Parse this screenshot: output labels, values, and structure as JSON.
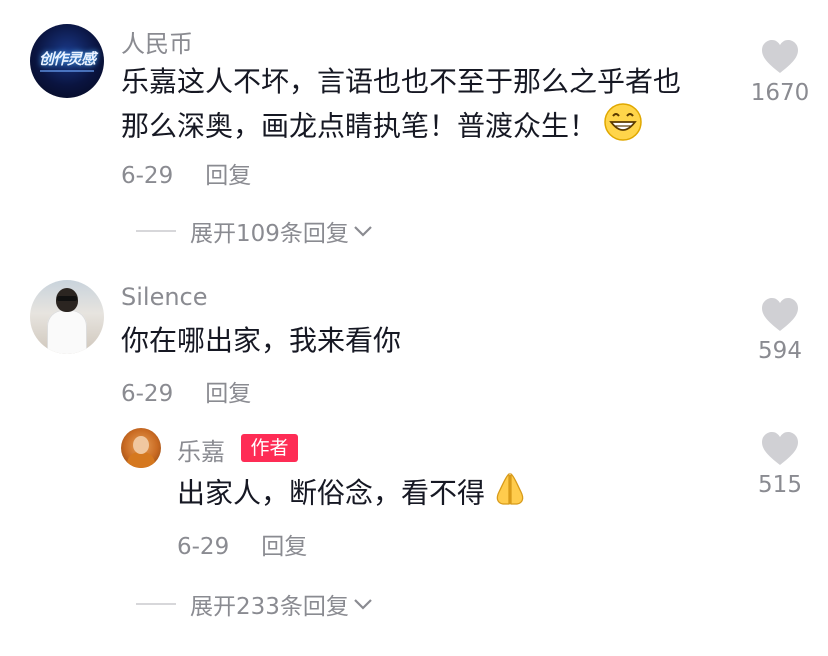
{
  "comments": [
    {
      "username": "人民币",
      "avatar_logo_text": "创作灵感",
      "text_line1": "乐嘉这人不坏，言语也也不至于那么之乎者也",
      "text_line2": "那么深奥，画龙点睛执笔！普渡众生！",
      "emoji": "grinning-face-emoji",
      "date": "6-29",
      "reply_label": "回复",
      "likes": "1670",
      "expand_label": "展开109条回复"
    },
    {
      "username": "Silence",
      "text_line1": "你在哪出家，我来看你",
      "date": "6-29",
      "reply_label": "回复",
      "likes": "594",
      "replies": [
        {
          "username": "乐嘉",
          "badge": "作者",
          "text_line1": "出家人，断俗念，看不得",
          "emoji": "folded-hands-emoji",
          "date": "6-29",
          "reply_label": "回复",
          "likes": "515"
        }
      ],
      "expand_label": "展开233条回复"
    }
  ],
  "colors": {
    "accent": "#fe2c55",
    "muted_text": "#8a8b91",
    "heart_gray": "#d0d0d4"
  },
  "icons": [
    "heart-icon",
    "chevron-down-icon"
  ]
}
